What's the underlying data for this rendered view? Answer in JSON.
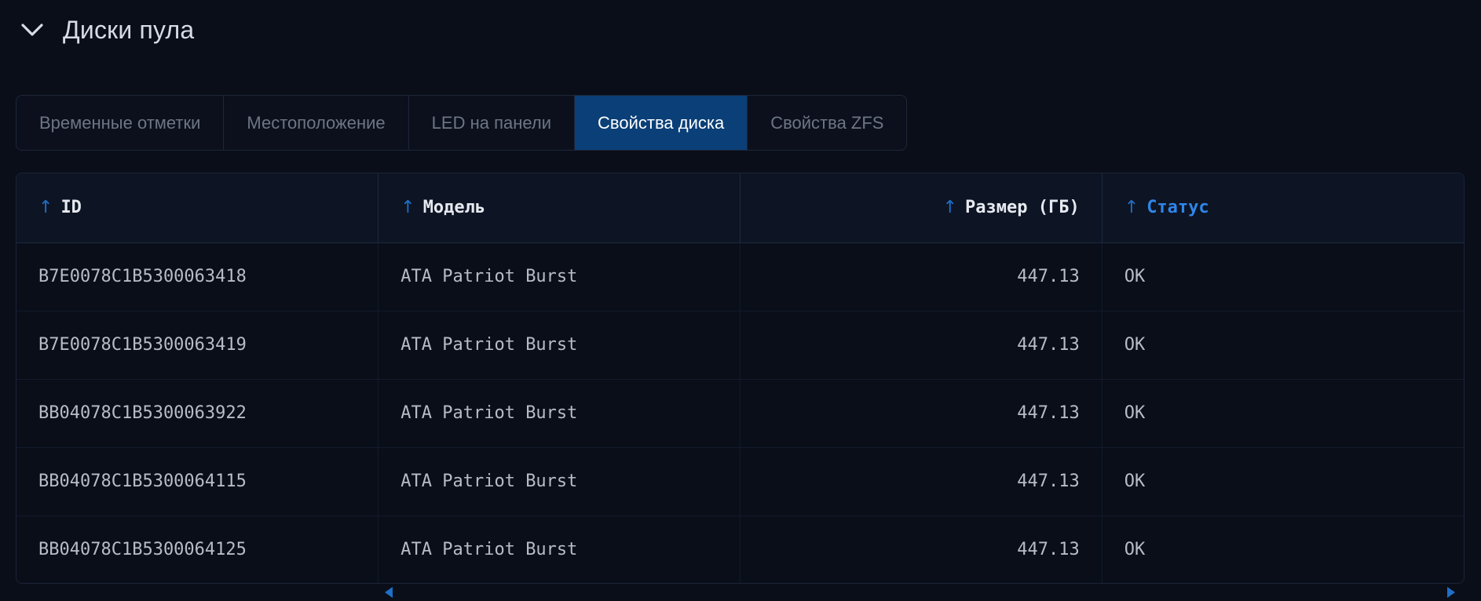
{
  "section": {
    "title": "Диски пула",
    "toggle_icon": "chevron-down-icon"
  },
  "tabs": [
    {
      "label": "Временные отметки",
      "active": false
    },
    {
      "label": "Местоположение",
      "active": false
    },
    {
      "label": "LED на панели",
      "active": false
    },
    {
      "label": "Свойства диска",
      "active": true
    },
    {
      "label": "Свойства ZFS",
      "active": false
    }
  ],
  "table": {
    "sort_icon": "arrow-up-icon",
    "columns": [
      {
        "label": "ID",
        "align": "left",
        "sorted": false
      },
      {
        "label": "Модель",
        "align": "left",
        "sorted": false
      },
      {
        "label": "Размер (ГБ)",
        "align": "right",
        "sorted": false
      },
      {
        "label": "Статус",
        "align": "left",
        "sorted": true
      }
    ],
    "rows": [
      {
        "id": "B7E0078C1B5300063418",
        "model": "ATA Patriot Burst",
        "size": "447.13",
        "status": "OK"
      },
      {
        "id": "B7E0078C1B5300063419",
        "model": "ATA Patriot Burst",
        "size": "447.13",
        "status": "OK"
      },
      {
        "id": "BB04078C1B5300063922",
        "model": "ATA Patriot Burst",
        "size": "447.13",
        "status": "OK"
      },
      {
        "id": "BB04078C1B5300064115",
        "model": "ATA Patriot Burst",
        "size": "447.13",
        "status": "OK"
      },
      {
        "id": "BB04078C1B5300064125",
        "model": "ATA Patriot Burst",
        "size": "447.13",
        "status": "OK"
      }
    ]
  },
  "colors": {
    "background": "#0a0e19",
    "active_tab": "#0a3f77",
    "accent": "#2f86e8"
  }
}
